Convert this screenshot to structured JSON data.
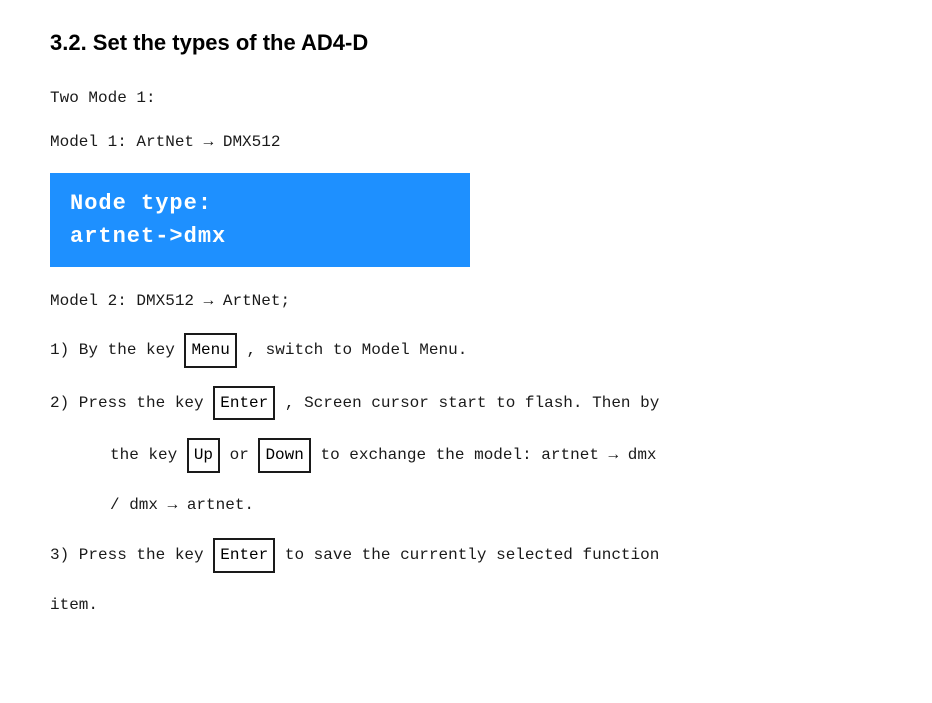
{
  "title": "3.2. Set the types of the AD4-D",
  "intro": "Two Mode 1:",
  "model1_label": "Model 1: ArtNet",
  "model1_arrow": "→",
  "model1_value": "DMX512",
  "lcd_line1": "Node type:",
  "lcd_line2": "artnet->dmx",
  "model2_label": "Model 2: DMX512",
  "model2_arrow": "→",
  "model2_value": "ArtNet;",
  "step1_pre": "1) By the key",
  "step1_key": "Menu",
  "step1_post": ", switch to Model Menu.",
  "step2_pre": "2) Press the key",
  "step2_key": "Enter",
  "step2_post": ",  Screen cursor start to flash. Then by",
  "step2_indent_pre": "the key",
  "step2_key_up": "Up",
  "step2_mid": "or",
  "step2_key_down": "Down",
  "step2_post2": "to exchange the model: artnet",
  "step2_arrow": "→",
  "step2_dmx": "dmx",
  "step2_indent2": "/ dmx",
  "step2_arrow2": "→",
  "step2_artnet": "artnet.",
  "step3_pre": "3) Press the key",
  "step3_key": "Enter",
  "step3_post": "to save the currently selected function",
  "step3_indent": "item."
}
